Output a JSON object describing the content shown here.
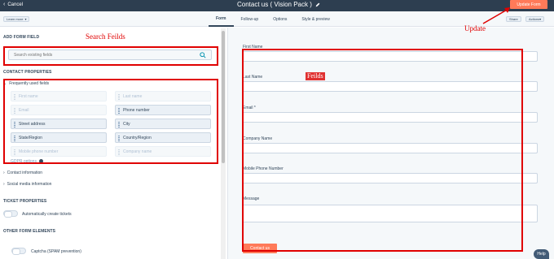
{
  "topbar": {
    "cancel_label": "Cancel",
    "title": "Contact us ( Vision Pack )",
    "update_button": "Update Form"
  },
  "subbar": {
    "learn_more": "Learn more",
    "tabs": [
      {
        "label": "Form",
        "active": true
      },
      {
        "label": "Follow-up",
        "active": false
      },
      {
        "label": "Options",
        "active": false
      },
      {
        "label": "Style & preview",
        "active": false
      }
    ],
    "share": "Share",
    "actions": "Actions"
  },
  "left": {
    "add_form_field": "ADD FORM FIELD",
    "search_placeholder": "Search existing fields",
    "contact_properties": "CONTACT PROPERTIES",
    "frequently_used": "Frequently used fields",
    "fields": [
      {
        "label": "First name",
        "enabled": false
      },
      {
        "label": "Last name",
        "enabled": false
      },
      {
        "label": "Email",
        "enabled": false
      },
      {
        "label": "Phone number",
        "enabled": true
      },
      {
        "label": "Street address",
        "enabled": true
      },
      {
        "label": "City",
        "enabled": true
      },
      {
        "label": "State/Region",
        "enabled": true
      },
      {
        "label": "Country/Region",
        "enabled": true
      },
      {
        "label": "Mobile phone number",
        "enabled": false
      },
      {
        "label": "Company name",
        "enabled": false
      }
    ],
    "gdpr_options": "GDPR options",
    "contact_information": "Contact information",
    "social_media": "Social media information",
    "ticket_properties": "TICKET PROPERTIES",
    "auto_create_tickets": "Automatically create tickets",
    "other_elements": "OTHER FORM ELEMENTS",
    "captcha": "Captcha (SPAM prevention)"
  },
  "form": {
    "fields": [
      {
        "label": "First Name"
      },
      {
        "label": "Last Name"
      },
      {
        "label": "Email *"
      },
      {
        "label": "Company Name"
      },
      {
        "label": "Mobile Phone Number"
      }
    ],
    "message_label": "Message",
    "submit": "Contact us",
    "help": "Help"
  },
  "annotations": {
    "search": "Search Feilds",
    "fields": "Feilds",
    "update": "Update"
  },
  "colors": {
    "topbar": "#2d3e50",
    "accent": "#ff7a59",
    "annotation": "#e00000"
  }
}
